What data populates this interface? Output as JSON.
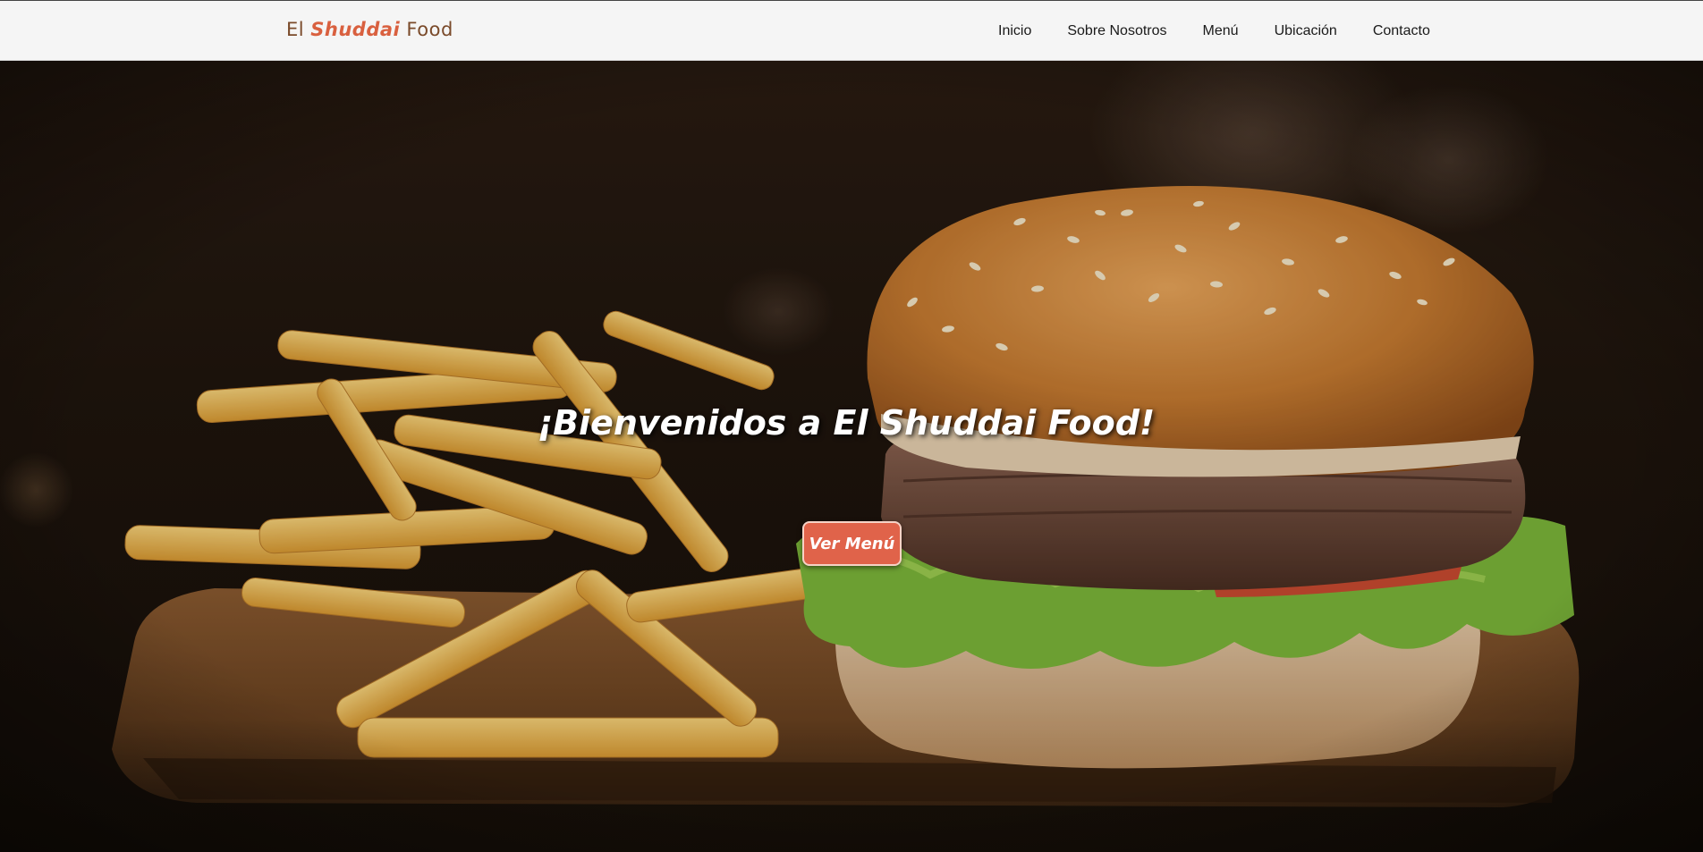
{
  "navbar": {
    "logo_prefix": "El ",
    "logo_accent": "Shuddai",
    "logo_suffix": " Food",
    "links": [
      {
        "label": "Inicio"
      },
      {
        "label": "Sobre Nosotros"
      },
      {
        "label": "Menú"
      },
      {
        "label": "Ubicación"
      },
      {
        "label": "Contacto"
      }
    ]
  },
  "hero": {
    "title": "¡Bienvenidos a El Shuddai Food!",
    "cta_label": "Ver Menú",
    "image_subject": "burger-and-fries-photo"
  },
  "colors": {
    "accent": "#e0634a",
    "logo_brown": "#7a4a2a",
    "navbar_bg": "#f5f5f5"
  }
}
